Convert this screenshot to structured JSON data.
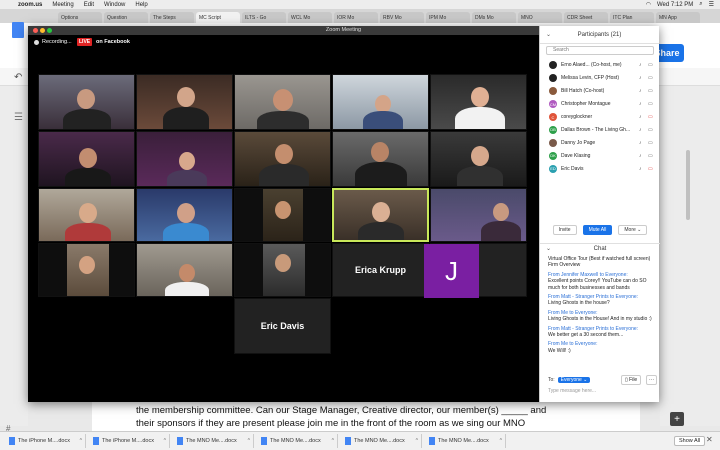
{
  "menubar": {
    "app": "zoom.us",
    "items": [
      "Meeting",
      "Edit",
      "Window",
      "Help"
    ],
    "clock": "Wed 7:12 PM"
  },
  "browser_tabs": [
    "Options",
    "Question",
    "The Steps",
    "MC Script",
    "ILTS - Go",
    "WCL Mo",
    "IOR Mo",
    "RBV Mo",
    "IPM Mo",
    "DMs Mo",
    "MNO",
    "CDR Sheet",
    "ITC Plan",
    "MN App"
  ],
  "docs": {
    "share_label": "Share",
    "doc_text": "the membership committee. Can our Stage Manager, Creative director, our member(s) _____ and their sponsors if they are present please join me in the front of the room as we sing our MNO induction song."
  },
  "downloads": {
    "items": [
      "The iPhone M....docx",
      "The iPhone M....docx",
      "The MNO Me....docx",
      "The MNO Me....docx",
      "The MNO Me....docx",
      "The MNO Me....docx"
    ],
    "show_all": "Show All"
  },
  "zoom": {
    "window_title": "Zoom Meeting",
    "recording_label": "Recording...",
    "live_label": "LIVE",
    "live_target": "on Facebook",
    "name_tiles": [
      "Erica Krupp",
      "Eric Davis"
    ],
    "avatar_letter": "J"
  },
  "participants": {
    "header": "Participants (21)",
    "search_placeholder": "Search",
    "list": [
      {
        "name": "Erno Alaed... (Co-host, me)",
        "initials": "",
        "color": "#222222"
      },
      {
        "name": "Melissa Levin, CFP (Host)",
        "initials": "",
        "color": "#222222"
      },
      {
        "name": "Bill Hatch (Co-host)",
        "initials": "",
        "color": "#8a5a3c"
      },
      {
        "name": "Christopher Montague",
        "initials": "CM",
        "color": "#b05ac0"
      },
      {
        "name": "coreyglockner",
        "initials": "C",
        "color": "#e0543a"
      },
      {
        "name": "Dallas Brown - The Living Gh...",
        "initials": "DB",
        "color": "#2ea04a"
      },
      {
        "name": "Danny Jo Page",
        "initials": "",
        "color": "#7a5a4a"
      },
      {
        "name": "Dave Klasing",
        "initials": "DK",
        "color": "#2ea04a"
      },
      {
        "name": "Eric Davis",
        "initials": "ED",
        "color": "#2aa0b0"
      }
    ],
    "invite_label": "Invite",
    "mute_all_label": "Mute All",
    "more_label": "More"
  },
  "chat": {
    "header": "Chat",
    "messages": [
      {
        "from": "",
        "text": "Virtual Office Tour (Best if watched full screen) Firm Overview"
      },
      {
        "from": "From Jennifer Maxwell to Everyone:",
        "text": "Excellent points Corey!! YouTube can do SO much for both businesses and bands"
      },
      {
        "from": "From Matt - Stranger Prints to Everyone:",
        "text": "Living Ghosts in the house?"
      },
      {
        "from": "From Me to Everyone:",
        "text": "Living Ghosts in the House! And in my studio :)"
      },
      {
        "from": "From Matt - Stranger Prints to Everyone:",
        "text": "We better get a 30 second them..."
      },
      {
        "from": "From Me to Everyone:",
        "text": "We Will! :)"
      }
    ],
    "to_label": "To:",
    "to_value": "Everyone",
    "file_label": "File",
    "input_placeholder": "Type message here..."
  }
}
